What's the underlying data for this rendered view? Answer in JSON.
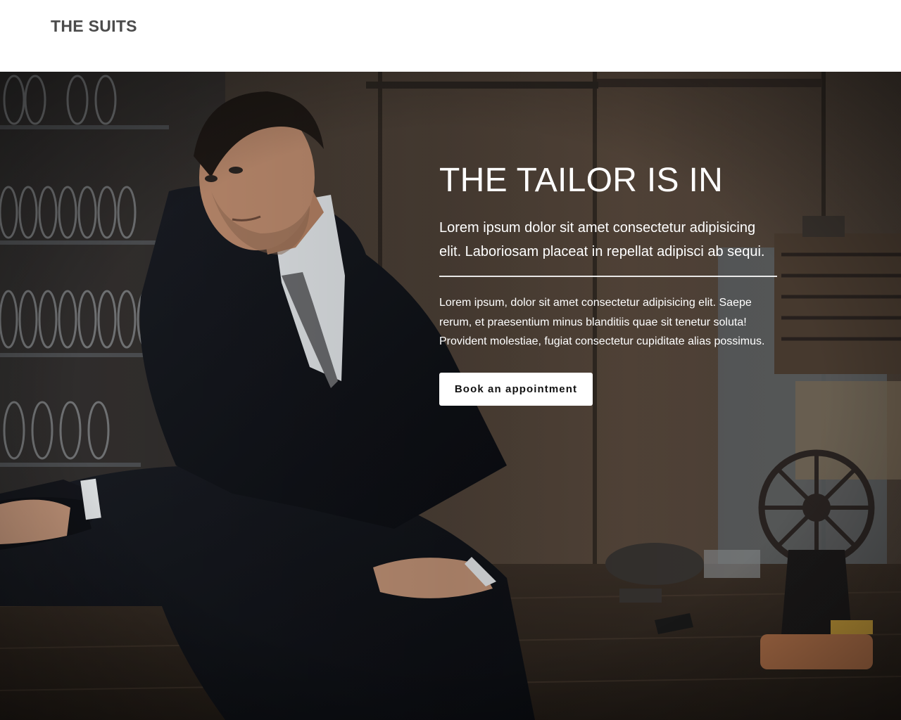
{
  "header": {
    "logo": "THE SUITS"
  },
  "hero": {
    "title": "THE TAILOR IS IN",
    "lead": "Lorem ipsum dolor sit amet consectetur adipisicing elit. Laboriosam placeat in repellat adipisci ab sequi.",
    "text": "Lorem ipsum, dolor sit amet consectetur adipisicing elit. Saepe rerum, et praesentium minus blanditiis quae sit tenetur soluta! Provident molestiae, fugiat consectetur cupiditate alias possimus.",
    "cta_label": "Book an appointment"
  }
}
